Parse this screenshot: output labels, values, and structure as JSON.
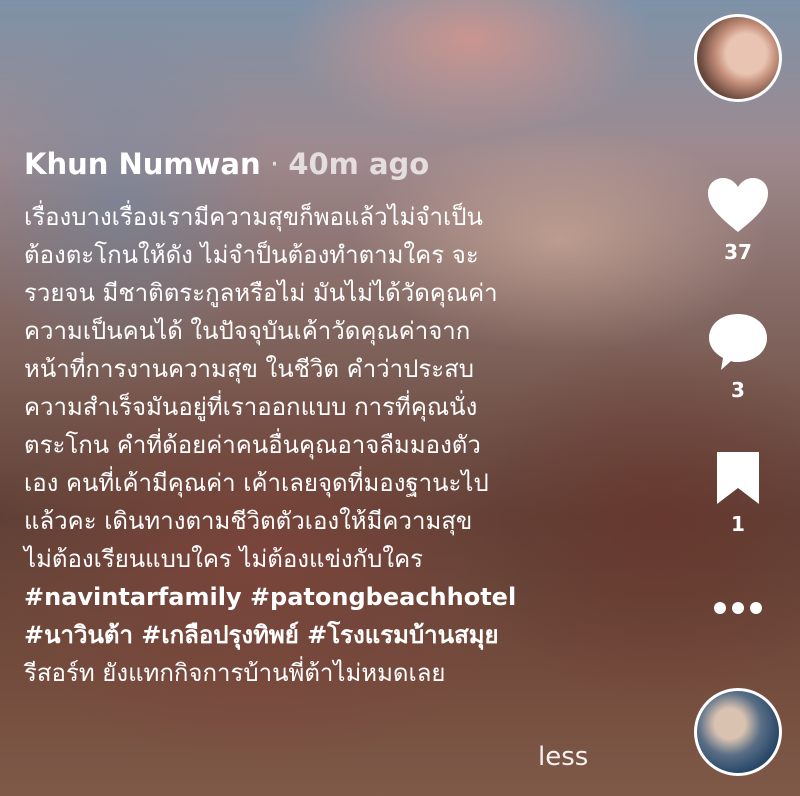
{
  "post": {
    "author": "Khun Numwan",
    "separator": "·",
    "time": "40m ago",
    "caption_lines": [
      "เรื่องบางเรื่องเรามีความสุขก็พอแล้วไม่จำเป็น",
      "ต้องตะโกนให้ดัง ไม่จำป็นต้องทำตามใคร จะ",
      "รวยจน มีชาติตระกูลหรือไม่ มันไม่ได้วัดคุณค่า",
      "ความเป็นคนได้ ในปัจจุบันเค้าวัดคุณค่าจาก",
      "หน้าที่การงานความสุข ในชีวิต คำว่าประสบ",
      "ความสำเร็จมันอยู่ที่เราออกแบบ การที่คุณนั่ง",
      "ตระโกน คำที่ด้อยค่าคนอื่นคุณอาจลืมมองตัว",
      "เอง คนที่เค้ามีคุณค่า เค้าเลยจุดที่มองฐานะไป",
      "แล้วคะ เดินทางตามชีวิตตัวเองให้มีความสุข",
      "ไม่ต้องเรียนแบบใคร ไม่ต้องแข่งกับใคร"
    ],
    "hashtag_line_1": "#navintarfamily #patongbeachhotel",
    "hashtag_line_2": "#นาวินต้า #เกลือปรุงทิพย์ #โรงแรมบ้านสมุย",
    "last_line": "รีสอร์ท ยังแทกกิจการบ้านพี่ต้าไม่หมดเลย",
    "less_label": "less"
  },
  "actions": {
    "likes": "37",
    "comments": "3",
    "saves": "1"
  },
  "icons": {
    "like": "heart-icon",
    "comment": "comment-bubble-icon",
    "save": "bookmark-icon",
    "more": "more-dots-icon"
  }
}
